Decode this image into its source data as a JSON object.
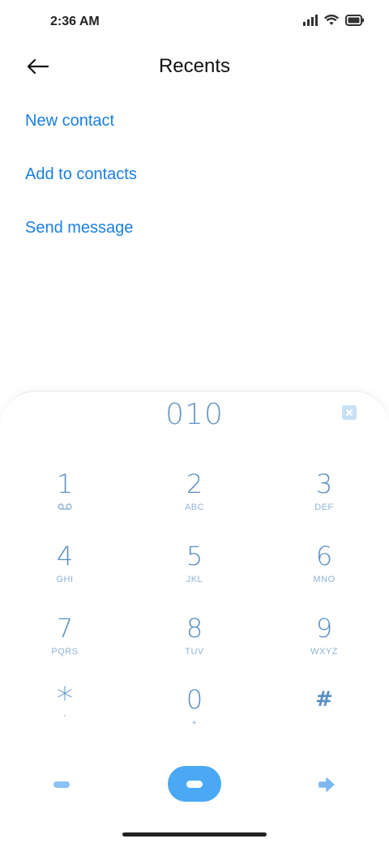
{
  "status_bar": {
    "time": "2:36 AM",
    "icons": [
      "signal-icon",
      "wifi-icon",
      "battery-icon"
    ]
  },
  "header": {
    "title": "Recents",
    "back_icon": "back-arrow-icon"
  },
  "actions": [
    {
      "label": "New contact"
    },
    {
      "label": "Add to contacts"
    },
    {
      "label": "Send message"
    }
  ],
  "dialer": {
    "number": "010",
    "clear_icon": "backspace-icon",
    "keys": [
      {
        "digit": "1",
        "letters": "",
        "sub_icon": "voicemail-icon"
      },
      {
        "digit": "2",
        "letters": "ABC"
      },
      {
        "digit": "3",
        "letters": "DEF"
      },
      {
        "digit": "4",
        "letters": "GHI"
      },
      {
        "digit": "5",
        "letters": "JKL"
      },
      {
        "digit": "6",
        "letters": "MNO"
      },
      {
        "digit": "7",
        "letters": "PQRS"
      },
      {
        "digit": "8",
        "letters": "TUV"
      },
      {
        "digit": "9",
        "letters": "WXYZ"
      },
      {
        "digit": "*",
        "letters": ","
      },
      {
        "digit": "0",
        "letters": "+"
      },
      {
        "digit": "#",
        "letters": ""
      }
    ]
  },
  "colors": {
    "accent": "#1a7fe0",
    "key_digit": "#5a8fc3",
    "key_letters": "#8fb3d6",
    "call_button": "#4aa8f5"
  }
}
